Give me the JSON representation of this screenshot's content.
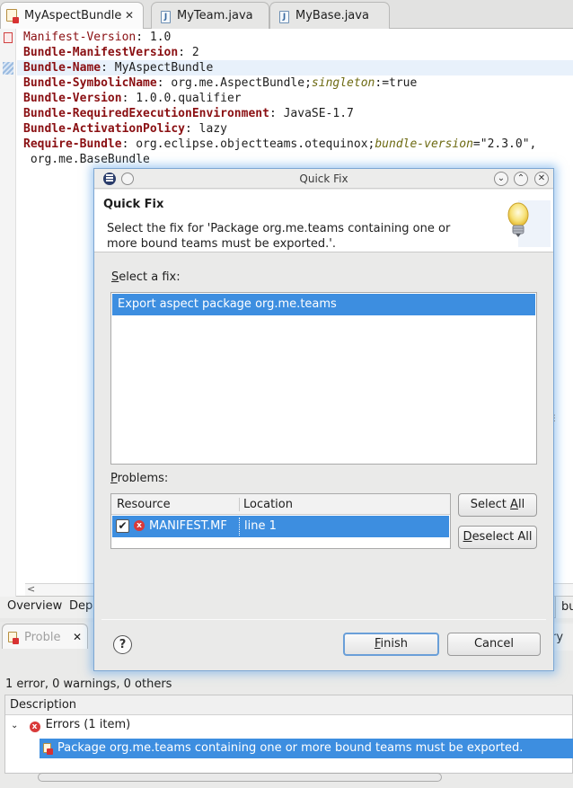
{
  "editor_tabs": [
    {
      "label": "MyAspectBundle",
      "icon": "manifest-icon",
      "active": true,
      "closable": true
    },
    {
      "label": "MyTeam.java",
      "icon": "java-file-icon",
      "active": false
    },
    {
      "label": "MyBase.java",
      "icon": "java-file-icon",
      "active": false
    }
  ],
  "manifest": {
    "l1_key": "Manifest-Version",
    "l1_sep": ": ",
    "l1_val": "1.0",
    "l2_key": "Bundle-ManifestVersion",
    "l2_sep": ": ",
    "l2_val": "2",
    "l3_key": "Bundle-Name",
    "l3_sep": ": ",
    "l3_val": "MyAspectBundle",
    "l4_key": "Bundle-SymbolicName",
    "l4_sep": ": ",
    "l4_val": "org.me.AspectBundle;",
    "l4_attr": "singleton",
    "l4_rest": ":=true",
    "l5_key": "Bundle-Version",
    "l5_sep": ": ",
    "l5_val": "1.0.0.qualifier",
    "l6_key": "Bundle-RequiredExecutionEnvironment",
    "l6_sep": ": ",
    "l6_val": "JavaSE-1.7",
    "l7_key": "Bundle-ActivationPolicy",
    "l7_sep": ": ",
    "l7_val": "lazy",
    "l8_key": "Require-Bundle",
    "l8_sep": ": ",
    "l8_val": "org.eclipse.objectteams.otequinox;",
    "l8_attr": "bundle-version",
    "l8_rest": "=\"2.3.0\",",
    "l9_val": " org.me.BaseBundle"
  },
  "editor_bottom_tabs": {
    "overview": "Overview",
    "dependencies": "Depe",
    "right_edge": "bu"
  },
  "dialog": {
    "window_title": "Quick Fix",
    "header_title": "Quick Fix",
    "header_message": "Select the fix for 'Package org.me.teams containing one or more bound teams must be exported.'.",
    "select_fix_prefix": "",
    "select_fix_mnemonic": "S",
    "select_fix_rest": "elect a fix:",
    "fixes": [
      "Export aspect package org.me.teams"
    ],
    "problems_mnemonic": "P",
    "problems_rest": "roblems:",
    "problems_columns": [
      "Resource",
      "Location"
    ],
    "problems_rows": [
      {
        "checked": true,
        "resource": "MANIFEST.MF",
        "location": "line 1"
      }
    ],
    "select_all_pre": "Select ",
    "select_all_mn": "A",
    "select_all_post": "ll",
    "deselect_all_mn": "D",
    "deselect_all_post": "eselect All",
    "finish_mn": "F",
    "finish_post": "inish",
    "cancel_label": "Cancel",
    "help_label": "?"
  },
  "problems_view": {
    "tab_label": "Proble",
    "summary": "1 error, 0 warnings, 0 others",
    "column": "Description",
    "group": "Errors (1 item)",
    "item": "Package org.me.teams containing one or more bound teams must be exported.",
    "right_edge": "ry"
  },
  "colors": {
    "selection": "#3d8ee0",
    "keyword": "#8a0f12",
    "attribute": "#6d6a12",
    "error": "#d93a3a"
  }
}
